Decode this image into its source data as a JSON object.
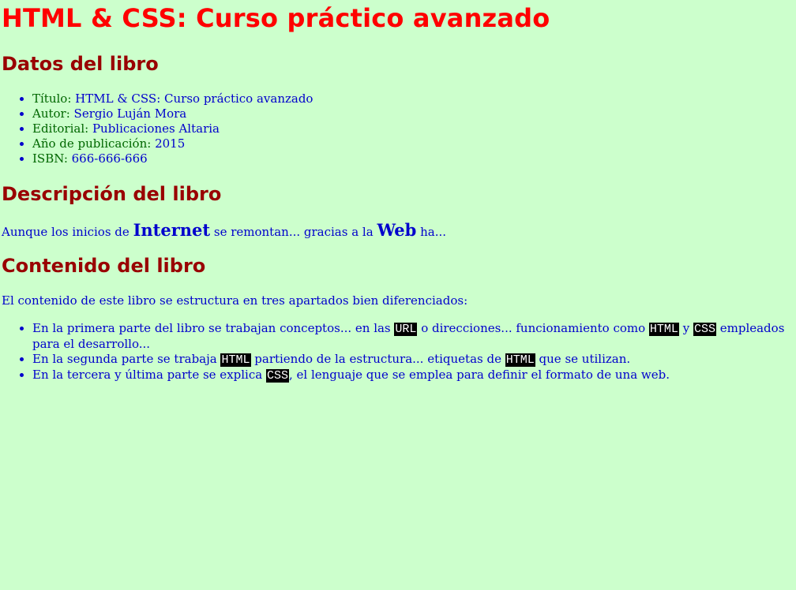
{
  "title": "HTML & CSS: Curso práctico avanzado",
  "datos": {
    "heading": "Datos del libro",
    "items": [
      {
        "label": "Título: ",
        "value": "HTML & CSS: Curso práctico avanzado"
      },
      {
        "label": "Autor: ",
        "value": "Sergio Luján Mora"
      },
      {
        "label": "Editorial: ",
        "value": "Publicaciones Altaria"
      },
      {
        "label": "Año de publicación: ",
        "value": "2015"
      },
      {
        "label": "ISBN: ",
        "value": "666-666-666"
      }
    ]
  },
  "descripcion": {
    "heading": "Descripción del libro",
    "t1": "Aunque los inicios de ",
    "b1": "Internet",
    "t2": " se remontan... gracias a la ",
    "b2": "Web",
    "t3": " ha..."
  },
  "contenido": {
    "heading": "Contenido del libro",
    "intro": "El contenido de este libro se estructura en tres apartados bien diferenciados:",
    "items": [
      {
        "p1": "En la primera parte del libro se trabajan conceptos... en las ",
        "c1": "URL",
        "p2": " o direcciones... funcionamiento como ",
        "c2": "HTML",
        "p3": " y ",
        "c3": "CSS",
        "p4": " empleados para el desarrollo..."
      },
      {
        "p1": "En la segunda parte se trabaja ",
        "c1": "HTML",
        "p2": " partiendo de la estructura... etiquetas de ",
        "c2": "HTML",
        "p3": " que se utilizan."
      },
      {
        "p1": "En la tercera y última parte se explica ",
        "c1": "CSS",
        "p2": ", el lenguaje que se emplea para definir el formato de una web."
      }
    ]
  },
  "colors": {
    "background": "#ccffcc",
    "title": "#ff0000",
    "heading": "#990000",
    "text": "#0000cc",
    "label": "#006600",
    "code_bg": "#000000",
    "code_fg": "#ffffff"
  }
}
